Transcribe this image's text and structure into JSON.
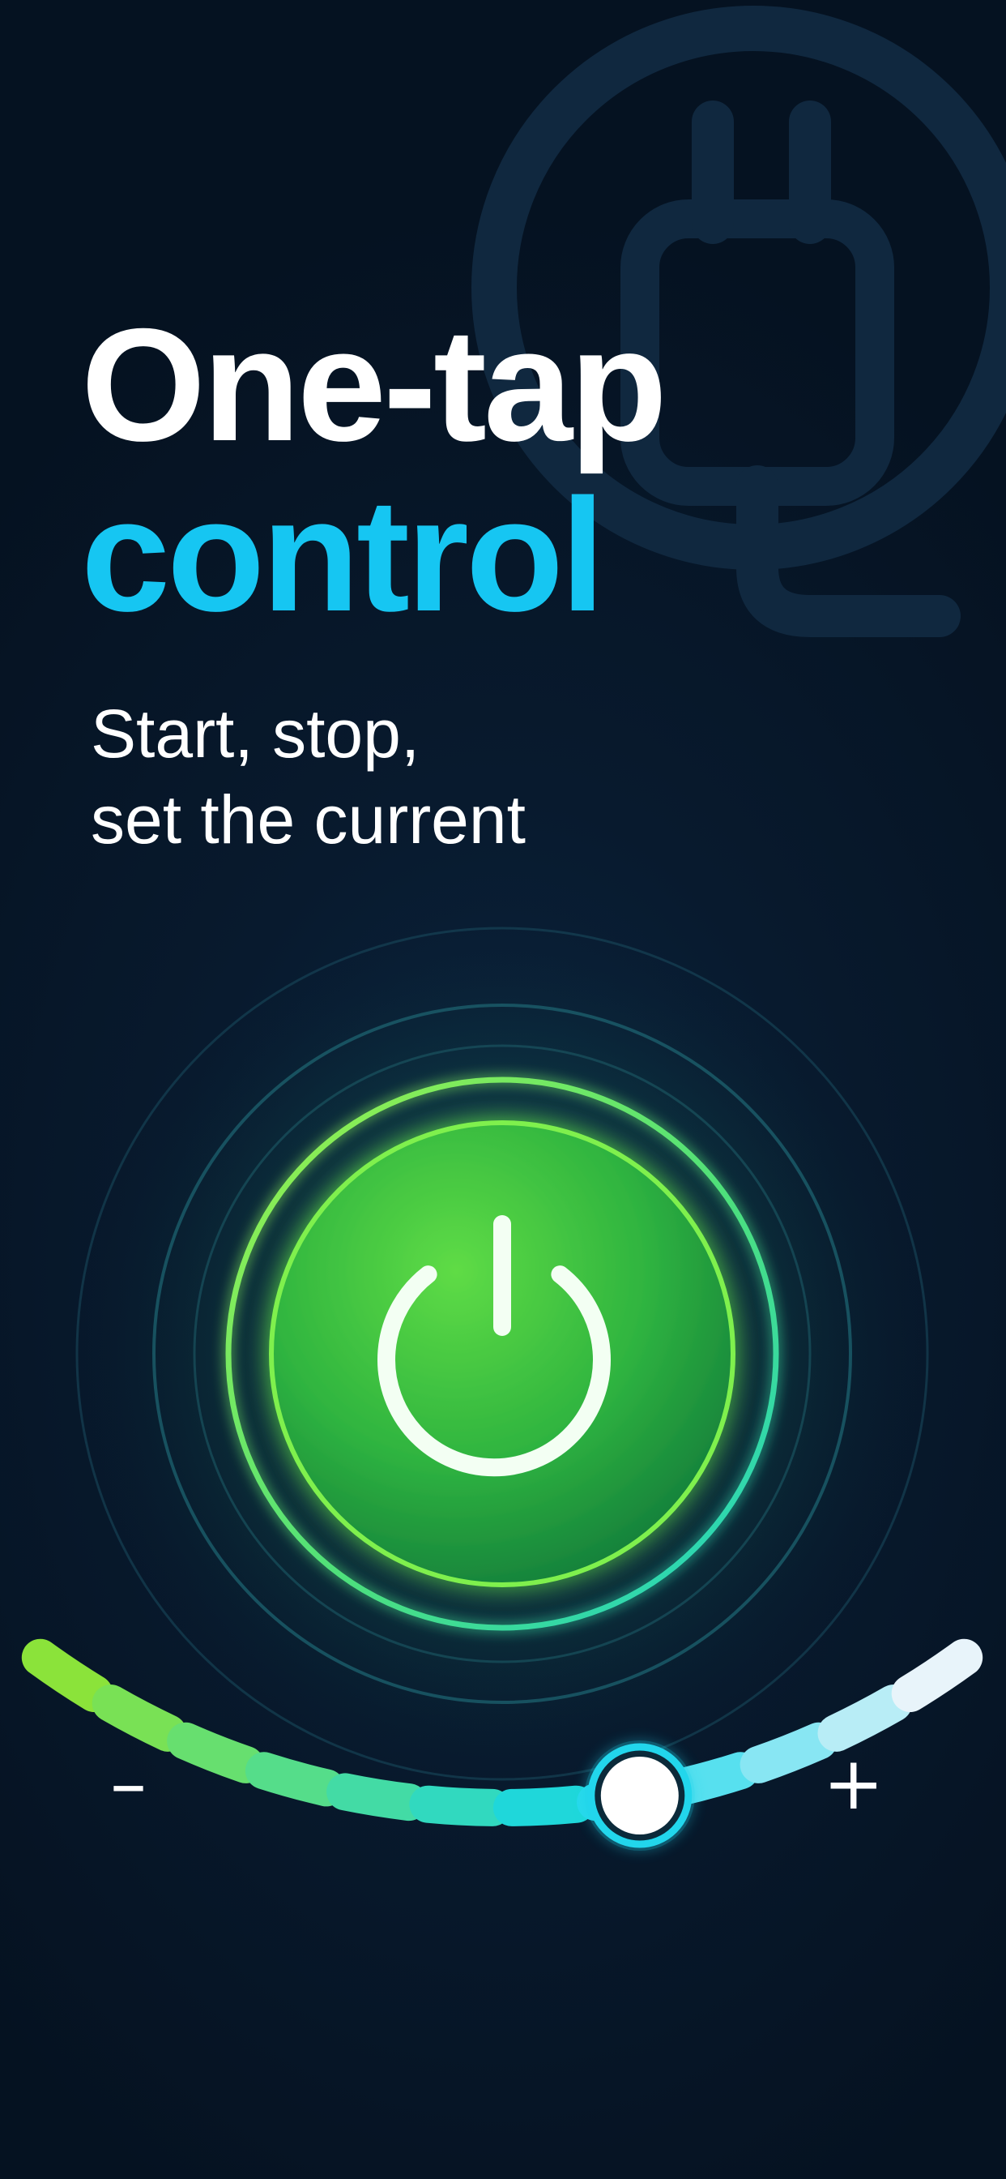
{
  "headline": {
    "line1": "One-tap",
    "line2": "control"
  },
  "subtitle": {
    "line1": "Start, stop,",
    "line2": "set the current"
  },
  "power_button": {
    "icon": "power-icon",
    "state": "on"
  },
  "current_slider": {
    "decrease_label": "–",
    "increase_label": "+",
    "segments": 12,
    "level": 0.64
  },
  "colors": {
    "background": "#071a2d",
    "headline_white": "#ffffff",
    "headline_accent": "#16c6f2",
    "power_green": "#3fcf3a",
    "ring_green": "#7cf04a",
    "slider_start": "#8be33a",
    "slider_mid": "#14d6ea",
    "slider_end": "#e6f2f8"
  }
}
